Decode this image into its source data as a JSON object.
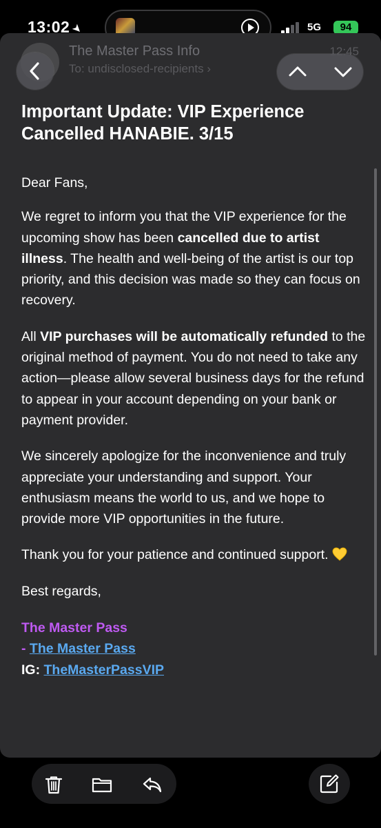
{
  "status_bar": {
    "time": "13:02",
    "network": "5G",
    "battery": "94"
  },
  "header": {
    "sender": "The Master Pass Info",
    "recipients": "To: undisclosed-recipients",
    "time": "12:45"
  },
  "email": {
    "subject": "Important Update: VIP Experience Cancelled HANABIE. 3/15",
    "greeting": "Dear Fans,",
    "p1_a": "We regret to inform you that the VIP experience for the upcoming show has been ",
    "p1_bold": "cancelled due to artist illness",
    "p1_b": ". The health and well-being of the artist is our top priority, and this decision was made so they can focus on recovery.",
    "p2_a": "All ",
    "p2_bold": "VIP purchases will be automatically refunded",
    "p2_b": " to the original method of payment. You do not need to take any action—please allow several business days for the refund to appear in your account depending on your bank or payment provider.",
    "p3": "We sincerely apologize for the inconvenience and truly appreciate your understanding and support. Your enthusiasm means the world to us, and we hope to provide more VIP opportunities in the future.",
    "p4": "Thank you for your patience and continued support.",
    "closing": "Best regards,",
    "signature_name": "The Master Pass",
    "signature_dash": "- ",
    "signature_link": "The Master Pass",
    "ig_label": "IG: ",
    "ig_link": "TheMasterPassVIP"
  },
  "colors": {
    "background": "#000000",
    "card": "#2c2c2e",
    "signature_purple": "#bf5af2",
    "link_blue": "#5aa9f0",
    "battery_green": "#34c759"
  },
  "icons": [
    "location-arrow-icon",
    "play-icon",
    "signal-icon",
    "back-chevron-icon",
    "chevron-up-icon",
    "chevron-down-icon",
    "yellow-heart-icon",
    "trash-icon",
    "folder-icon",
    "reply-icon",
    "compose-icon"
  ]
}
